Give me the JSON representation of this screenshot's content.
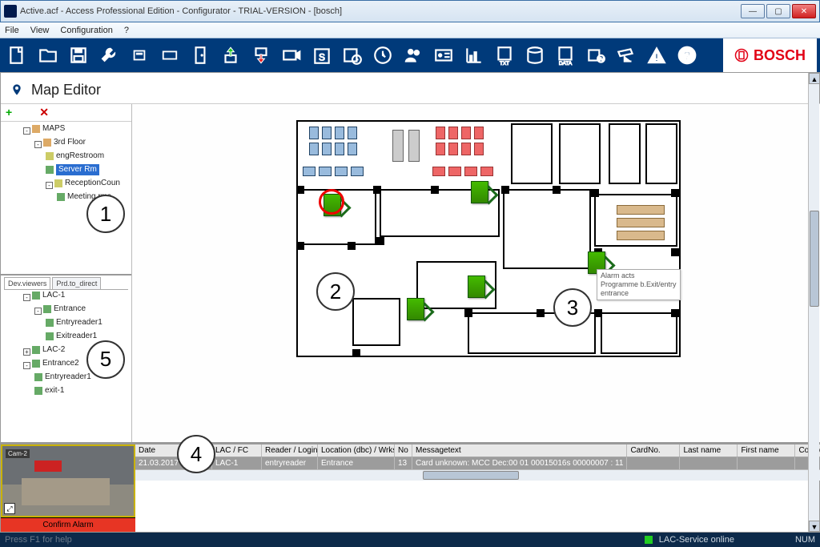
{
  "window": {
    "title": "Active.acf - Access Professional Edition - Configurator - TRIAL-VERSION - [bosch]"
  },
  "menu": {
    "items": [
      "File",
      "View",
      "Configuration",
      "?"
    ]
  },
  "brand": {
    "name": "BOSCH"
  },
  "page": {
    "title": "Map Editor"
  },
  "sidebar": {
    "tabs": [
      "Dev.viewers",
      "Prd.to_direct"
    ],
    "tree1": {
      "root": "MAPS",
      "items": [
        "3rd Floor",
        "engRestroom",
        "Server Rm",
        "ReceptionCoun",
        "Meeting rms"
      ]
    },
    "tree2": {
      "items": [
        "LAC-1",
        "Entrance",
        "Entryreader1",
        "Exitreader1",
        "LAC-2",
        "Entrance2",
        "Entryreader1",
        "exit-1"
      ]
    }
  },
  "tooltip": {
    "line1": "Alarm acts",
    "line2": "Programme b.Exit/entry",
    "line3": "entrance"
  },
  "callouts": {
    "c1": "1",
    "c2": "2",
    "c3": "3",
    "c4": "4",
    "c5": "5"
  },
  "camera": {
    "label": "Cam-2",
    "confirm": "Confirm Alarm"
  },
  "log": {
    "columns": [
      "Date",
      "LAC / FC",
      "Reader / Login",
      "Location (dbc) / Wrkst.",
      "No",
      "Messagetext",
      "CardNo.",
      "Last name",
      "First name",
      "Company"
    ],
    "row": {
      "date": "21.03.2017 12:11",
      "lac": "LAC-1",
      "reader": "entryreader",
      "location": "Entrance",
      "no": "13",
      "msg": "Card unknown: MCC Dec:00 01 00015016s 00000007 : 11",
      "card": "",
      "last": "",
      "first": "",
      "company": ""
    }
  },
  "status": {
    "help": "Press F1 for help",
    "service": "LAC-Service online",
    "num": "NUM"
  }
}
